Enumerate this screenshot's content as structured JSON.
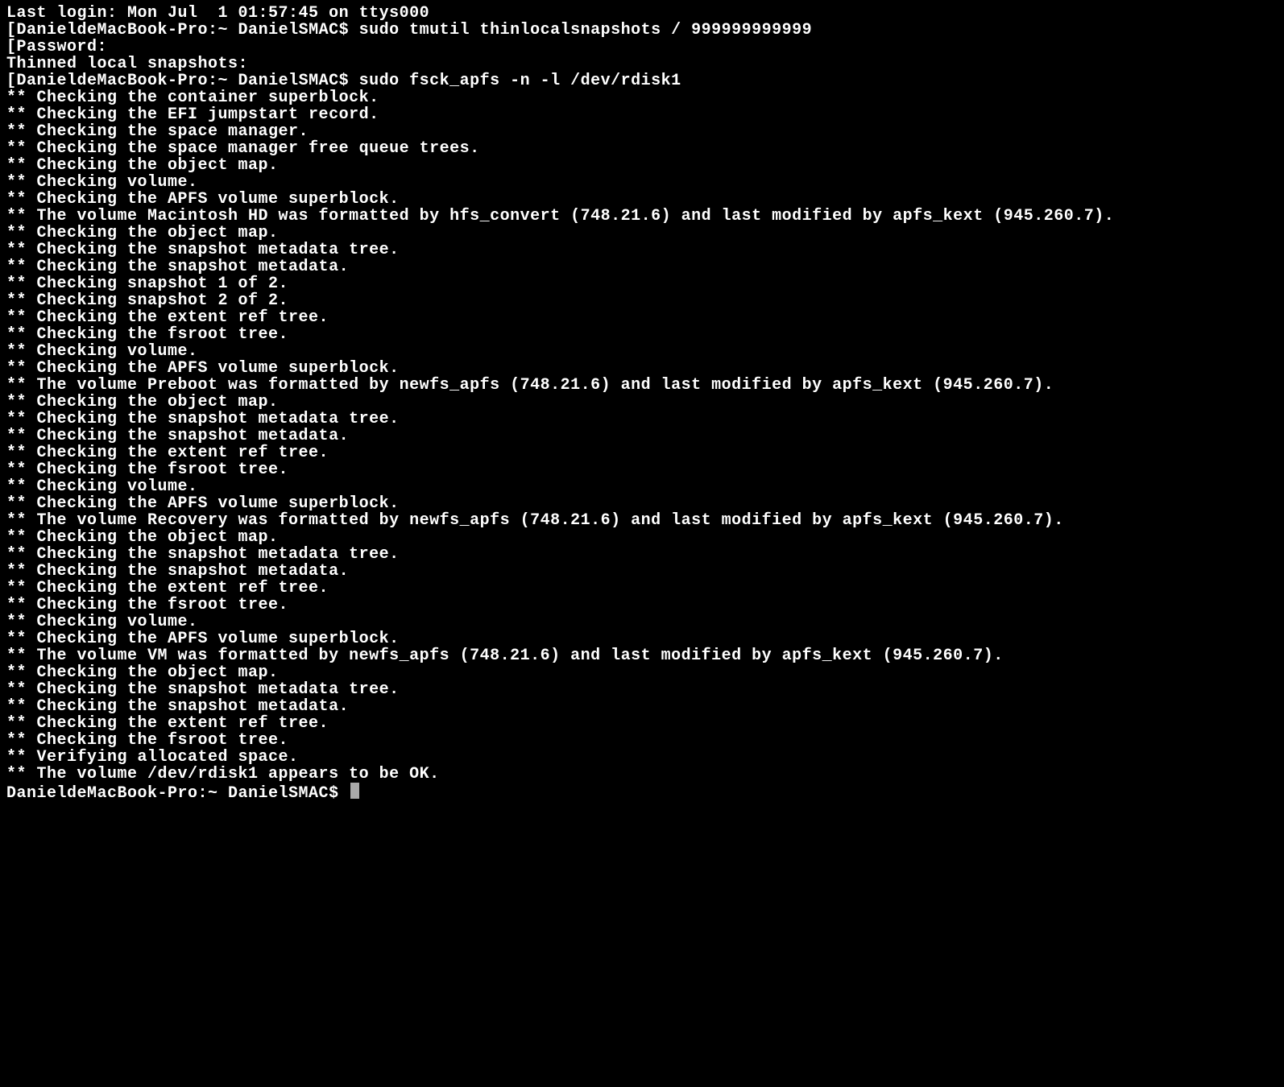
{
  "terminal": {
    "lines": [
      {
        "kind": "out",
        "text": "Last login: Mon Jul  1 01:57:45 on ttys000"
      },
      {
        "kind": "cmd",
        "bracket": true,
        "prompt": "DanieldeMacBook-Pro:~ DanielSMAC$ ",
        "command": "sudo tmutil thinlocalsnapshots / 999999999999"
      },
      {
        "kind": "out",
        "bracket": true,
        "text": "Password:"
      },
      {
        "kind": "out",
        "text": "Thinned local snapshots:"
      },
      {
        "kind": "cmd",
        "bracket": true,
        "prompt": "DanieldeMacBook-Pro:~ DanielSMAC$ ",
        "command": "sudo fsck_apfs -n -l /dev/rdisk1"
      },
      {
        "kind": "out",
        "text": "** Checking the container superblock."
      },
      {
        "kind": "out",
        "text": "** Checking the EFI jumpstart record."
      },
      {
        "kind": "out",
        "text": "** Checking the space manager."
      },
      {
        "kind": "out",
        "text": "** Checking the space manager free queue trees."
      },
      {
        "kind": "out",
        "text": "** Checking the object map."
      },
      {
        "kind": "out",
        "text": "** Checking volume."
      },
      {
        "kind": "out",
        "text": "** Checking the APFS volume superblock."
      },
      {
        "kind": "out",
        "text": "** The volume Macintosh HD was formatted by hfs_convert (748.21.6) and last modified by apfs_kext (945.260.7)."
      },
      {
        "kind": "out",
        "text": "** Checking the object map."
      },
      {
        "kind": "out",
        "text": "** Checking the snapshot metadata tree."
      },
      {
        "kind": "out",
        "text": "** Checking the snapshot metadata."
      },
      {
        "kind": "out",
        "text": "** Checking snapshot 1 of 2."
      },
      {
        "kind": "out",
        "text": "** Checking snapshot 2 of 2."
      },
      {
        "kind": "out",
        "text": "** Checking the extent ref tree."
      },
      {
        "kind": "out",
        "text": "** Checking the fsroot tree."
      },
      {
        "kind": "out",
        "text": "** Checking volume."
      },
      {
        "kind": "out",
        "text": "** Checking the APFS volume superblock."
      },
      {
        "kind": "out",
        "text": "** The volume Preboot was formatted by newfs_apfs (748.21.6) and last modified by apfs_kext (945.260.7)."
      },
      {
        "kind": "out",
        "text": "** Checking the object map."
      },
      {
        "kind": "out",
        "text": "** Checking the snapshot metadata tree."
      },
      {
        "kind": "out",
        "text": "** Checking the snapshot metadata."
      },
      {
        "kind": "out",
        "text": "** Checking the extent ref tree."
      },
      {
        "kind": "out",
        "text": "** Checking the fsroot tree."
      },
      {
        "kind": "out",
        "text": "** Checking volume."
      },
      {
        "kind": "out",
        "text": "** Checking the APFS volume superblock."
      },
      {
        "kind": "out",
        "text": "** The volume Recovery was formatted by newfs_apfs (748.21.6) and last modified by apfs_kext (945.260.7)."
      },
      {
        "kind": "out",
        "text": "** Checking the object map."
      },
      {
        "kind": "out",
        "text": "** Checking the snapshot metadata tree."
      },
      {
        "kind": "out",
        "text": "** Checking the snapshot metadata."
      },
      {
        "kind": "out",
        "text": "** Checking the extent ref tree."
      },
      {
        "kind": "out",
        "text": "** Checking the fsroot tree."
      },
      {
        "kind": "out",
        "text": "** Checking volume."
      },
      {
        "kind": "out",
        "text": "** Checking the APFS volume superblock."
      },
      {
        "kind": "out",
        "text": "** The volume VM was formatted by newfs_apfs (748.21.6) and last modified by apfs_kext (945.260.7)."
      },
      {
        "kind": "out",
        "text": "** Checking the object map."
      },
      {
        "kind": "out",
        "text": "** Checking the snapshot metadata tree."
      },
      {
        "kind": "out",
        "text": "** Checking the snapshot metadata."
      },
      {
        "kind": "out",
        "text": "** Checking the extent ref tree."
      },
      {
        "kind": "out",
        "text": "** Checking the fsroot tree."
      },
      {
        "kind": "out",
        "text": "** Verifying allocated space."
      },
      {
        "kind": "out",
        "text": "** The volume /dev/rdisk1 appears to be OK."
      },
      {
        "kind": "cmd",
        "bracket": false,
        "cursor": true,
        "prompt": "DanieldeMacBook-Pro:~ DanielSMAC$ ",
        "command": ""
      }
    ]
  }
}
